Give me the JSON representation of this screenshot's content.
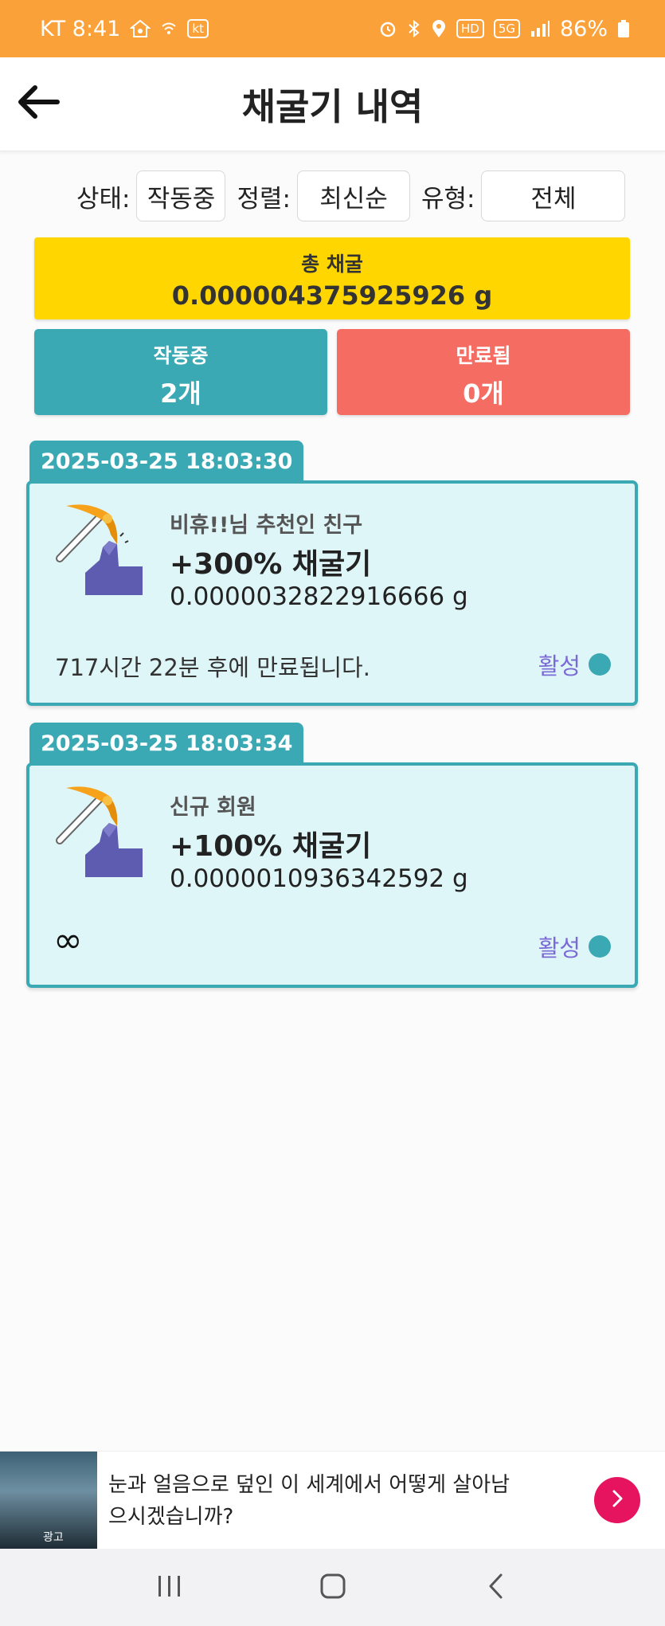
{
  "statusbar": {
    "carrier_time": "KT 8:41",
    "carrier_badge": "kt",
    "hd_badge": "HD",
    "network": "5G",
    "battery": "86%"
  },
  "header": {
    "title": "채굴기 내역"
  },
  "filters": {
    "status_label": "상태:",
    "status_value": "작동중",
    "sort_label": "정렬:",
    "sort_value": "최신순",
    "type_label": "유형:",
    "type_value": "전체"
  },
  "summary": {
    "total_label": "총 채굴",
    "total_value": "0.000004375925926 g",
    "active_label": "작동중",
    "active_value": "2개",
    "expired_label": "만료됨",
    "expired_value": "0개"
  },
  "colors": {
    "status_bar": "#fba13a",
    "total": "#ffd600",
    "active": "#3aa9b4",
    "expired": "#f46c62",
    "card_bg": "#dff6f8",
    "status_text": "#7b6ad6"
  },
  "miners": [
    {
      "date": "2025-03-25 18:03:30",
      "subtitle": "비휴!!님 추천인 친구",
      "name": "+300% 채굴기",
      "amount": "0.0000032822916666 g",
      "expire": "717시간 22분 후에 만료됩니다.",
      "status": "활성"
    },
    {
      "date": "2025-03-25 18:03:34",
      "subtitle": "신규 회원",
      "name": "+100% 채굴기",
      "amount": "0.0000010936342592 g",
      "expire": "∞",
      "status": "활성"
    }
  ],
  "ad": {
    "badge": "광고",
    "text": "눈과 얼음으로 덮인 이 세계에서 어떻게 살아남으시겠습니까?"
  },
  "icons": {
    "back": "arrow-left-icon",
    "miner": "pickaxe-icon",
    "ad_next": "chevron-right-icon",
    "nav_recent": "recent-apps-icon",
    "nav_home": "home-icon",
    "nav_back": "nav-back-icon"
  }
}
